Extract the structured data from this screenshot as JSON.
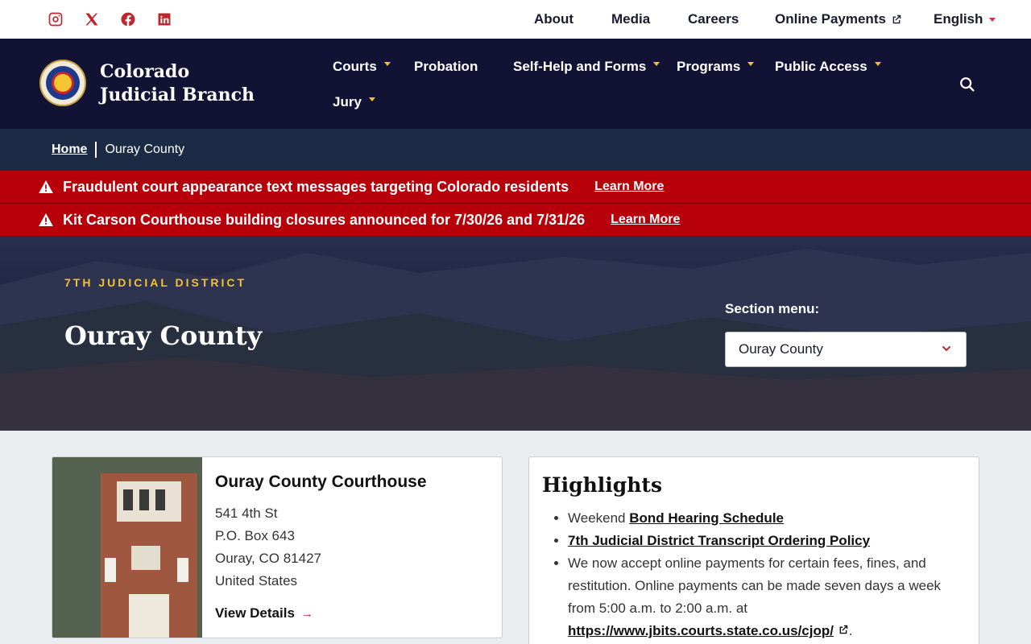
{
  "utility": {
    "social": [
      "instagram-icon",
      "x-icon",
      "facebook-icon",
      "linkedin-icon"
    ],
    "links": {
      "about": "About",
      "media": "Media",
      "careers": "Careers",
      "payments": "Online Payments",
      "language": "English"
    }
  },
  "header": {
    "brand": "Colorado Judicial Branch",
    "nav": {
      "courts": "Courts",
      "probation": "Probation",
      "self_help": "Self-Help and Forms",
      "programs": "Programs",
      "public_access": "Public Access",
      "jury": "Jury"
    }
  },
  "breadcrumb": {
    "home": "Home",
    "current": "Ouray County"
  },
  "alerts": [
    {
      "text": "Fraudulent court appearance text messages targeting Colorado residents",
      "link": "Learn More"
    },
    {
      "text": "Kit Carson Courthouse building closures announced for 7/30/26 and 7/31/26",
      "link": "Learn More"
    }
  ],
  "hero": {
    "eyebrow": "7TH JUDICIAL DISTRICT",
    "title": "Ouray County",
    "section_label": "Section menu:",
    "section_selected": "Ouray County"
  },
  "courthouse": {
    "name": "Ouray County Courthouse",
    "street": "541 4th St",
    "po_box": "P.O. Box 643",
    "city": "Ouray, CO 81427",
    "country": "United States",
    "view": "View Details"
  },
  "highlights": {
    "title": "Highlights",
    "item1_prefix": "Weekend",
    "item1_link": "Bond Hearing Schedule",
    "item2_link": "7th Judicial District Transcript Ordering Policy",
    "item3_text": "We now accept online payments for certain fees, fines, and restitution. Online payments can be made seven days a week from 5:00 a.m. to 2:00 a.m. at",
    "item3_link": "https://www.jbits.courts.state.co.us/cjop/"
  },
  "colors": {
    "navy": "#121234",
    "alert_red": "#b70009",
    "gold": "#f2c230",
    "brand_red": "#c0262d"
  }
}
